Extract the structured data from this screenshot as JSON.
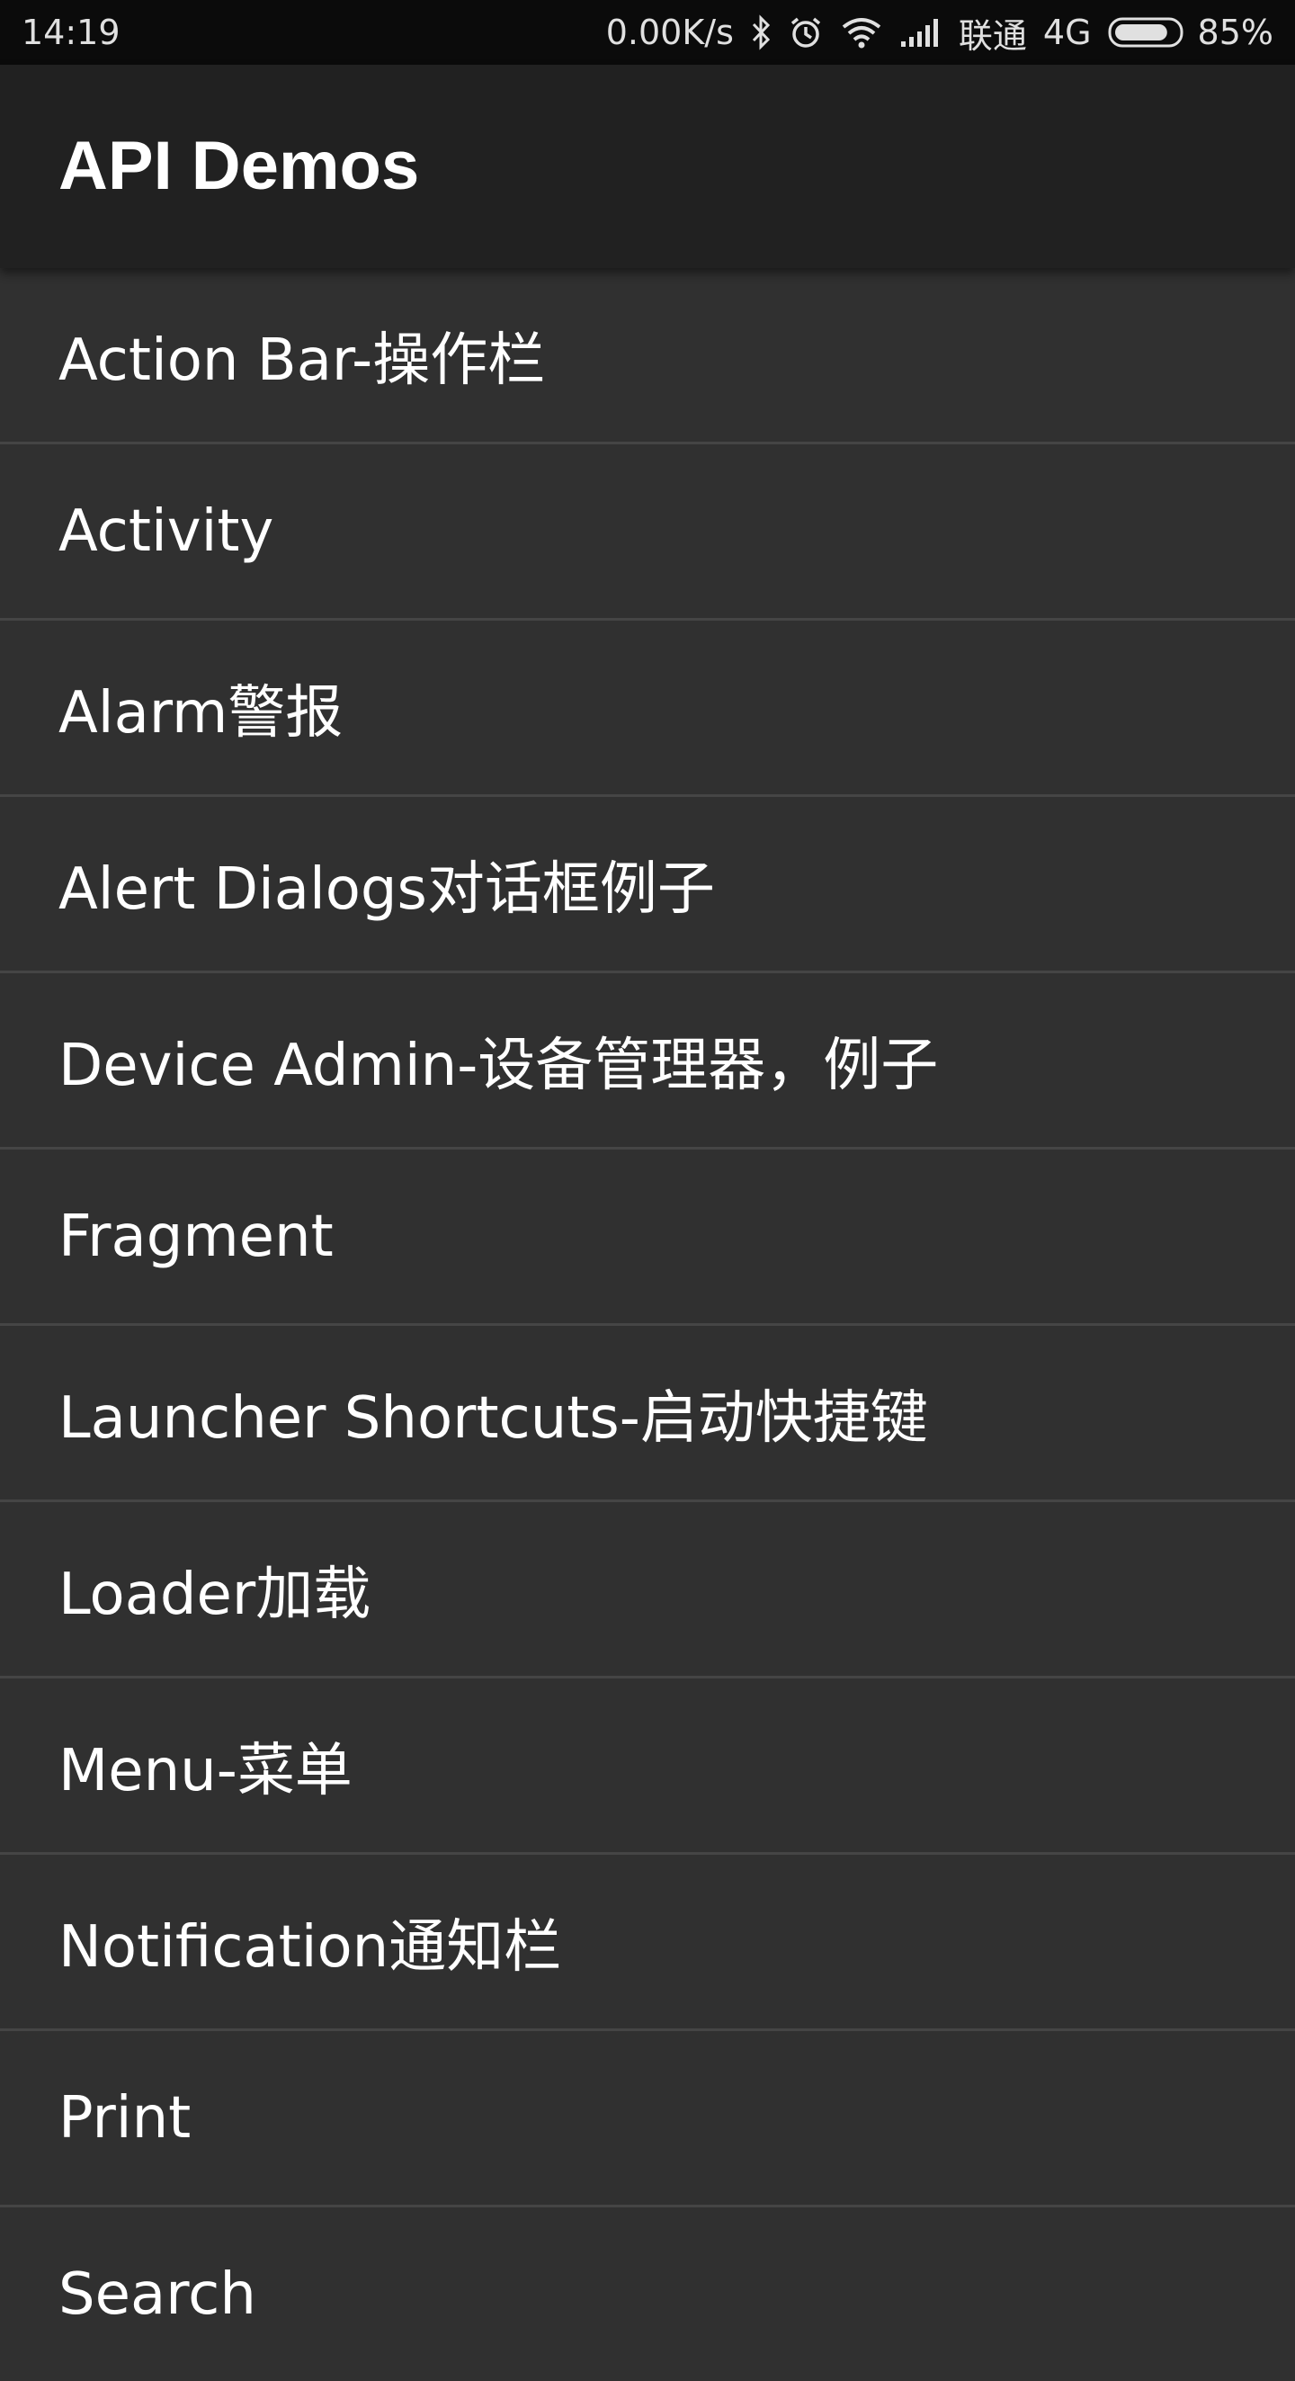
{
  "status_bar": {
    "time": "14:19",
    "net_speed": "0.00K/s",
    "carrier": "联通",
    "network_type": "4G",
    "battery_percent": "85%",
    "battery_level": 0.85,
    "icons": [
      "bluetooth-icon",
      "alarm-icon",
      "wifi-icon",
      "signal-icon",
      "battery-icon"
    ]
  },
  "app_bar": {
    "title": "API Demos"
  },
  "list": {
    "items": [
      {
        "label": "Action Bar-操作栏"
      },
      {
        "label": "Activity"
      },
      {
        "label": "Alarm警报"
      },
      {
        "label": "Alert Dialogs对话框例子"
      },
      {
        "label": "Device Admin-设备管理器，例子"
      },
      {
        "label": "Fragment"
      },
      {
        "label": "Launcher Shortcuts-启动快捷键"
      },
      {
        "label": "Loader加载"
      },
      {
        "label": "Menu-菜单"
      },
      {
        "label": "Notification通知栏"
      },
      {
        "label": "Print"
      },
      {
        "label": "Search"
      }
    ]
  },
  "colors": {
    "status_bar_bg": "#0b0b0b",
    "app_bar_bg": "#212121",
    "list_bg": "#303030",
    "divider": "#454545",
    "text": "#ffffff"
  }
}
